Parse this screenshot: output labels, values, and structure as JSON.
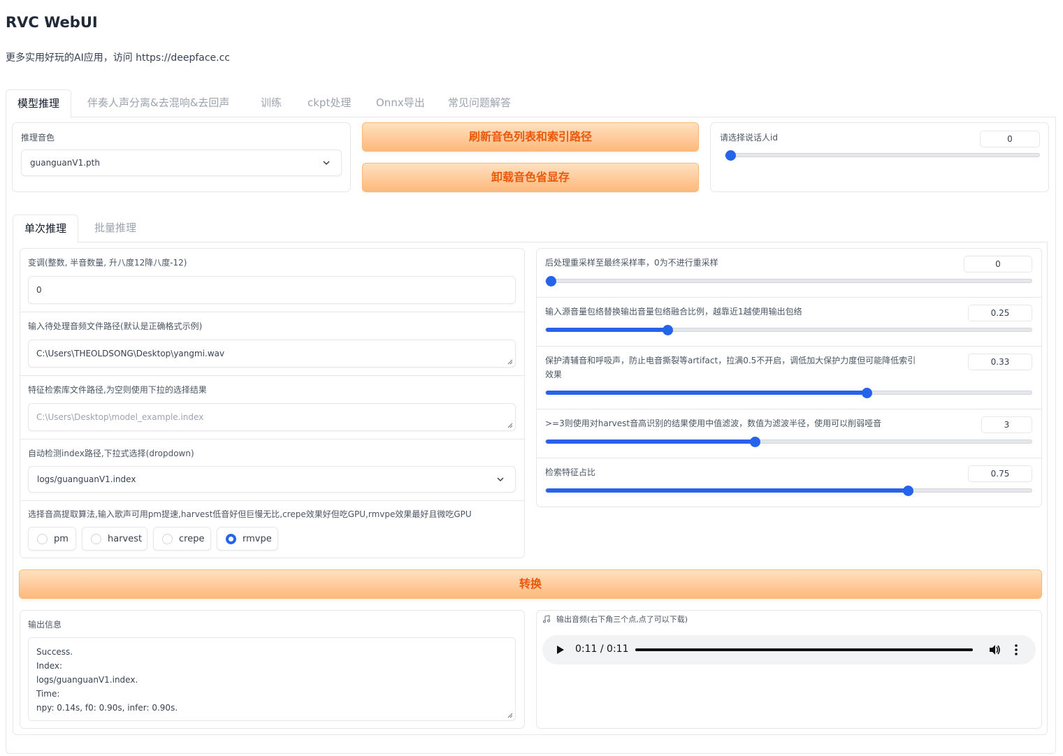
{
  "app": {
    "title": "RVC WebUI",
    "description": "更多实用好玩的AI应用，访问 https://deepface.cc"
  },
  "main_tabs": [
    "模型推理",
    "伴奏人声分离&去混响&去回声",
    "训练",
    "ckpt处理",
    "Onnx导出",
    "常见问题解答"
  ],
  "voice_box": {
    "label": "推理音色",
    "selected": "guanguanV1.pth"
  },
  "buttons": {
    "refresh": "刷新音色列表和索引路径",
    "unload": "卸载音色省显存",
    "convert": "转换"
  },
  "speaker": {
    "label": "请选择说话人id",
    "value": "0",
    "fraction": 0
  },
  "sub_tabs": [
    "单次推理",
    "批量推理"
  ],
  "left_form": {
    "transpose": {
      "label": "变调(整数, 半音数量, 升八度12降八度-12)",
      "value": "0"
    },
    "input_path": {
      "label": "输入待处理音频文件路径(默认是正确格式示例)",
      "value": "C:\\Users\\THEOLDSONG\\Desktop\\yangmi.wav"
    },
    "index_path": {
      "label": "特征检索库文件路径,为空则使用下拉的选择结果",
      "placeholder": "C:\\Users\\Desktop\\model_example.index"
    },
    "auto_index": {
      "label": "自动检测index路径,下拉式选择(dropdown)",
      "selected": "logs/guanguanV1.index"
    },
    "f0_method": {
      "label": "选择音高提取算法,输入歌声可用pm提速,harvest低音好但巨慢无比,crepe效果好但吃GPU,rmvpe效果最好且微吃GPU",
      "options": [
        "pm",
        "harvest",
        "crepe",
        "rmvpe"
      ],
      "selected": "rmvpe"
    }
  },
  "right_sliders": [
    {
      "label": "后处理重采样至最终采样率，0为不进行重采样",
      "value": "0",
      "fraction": 0.0
    },
    {
      "label": "输入源音量包络替换输出音量包络融合比例，越靠近1越使用输出包络",
      "value": "0.25",
      "fraction": 0.25
    },
    {
      "label": "保护清辅音和呼吸声，防止电音撕裂等artifact，拉满0.5不开启，调低加大保护力度但可能降低索引",
      "label2": "效果",
      "value": "0.33",
      "fraction": 0.66
    },
    {
      "label": ">=3则使用对harvest音高识别的结果使用中值滤波，数值为滤波半径，使用可以削弱哑音",
      "value": "3",
      "fraction": 0.43
    },
    {
      "label": "检索特征占比",
      "value": "0.75",
      "fraction": 0.745
    }
  ],
  "output": {
    "info_label": "输出信息",
    "info_lines": [
      "Success.",
      "Index:",
      "logs/guanguanV1.index.",
      "Time:",
      "npy: 0.14s, f0: 0.90s, infer: 0.90s."
    ],
    "audio_label": "输出音频(右下角三个点,点了可以下载)",
    "time": "0:11 / 0:11",
    "progress": 1.0
  },
  "colors": {
    "accent": "#2563eb",
    "button_text": "#ea580c",
    "button_bg_top": "#ffe1c0",
    "button_bg_bottom": "#fdb97b"
  },
  "icons": [
    "chevron-down-icon",
    "play-icon",
    "volume-icon",
    "more-vert-icon",
    "music-note-icon"
  ]
}
